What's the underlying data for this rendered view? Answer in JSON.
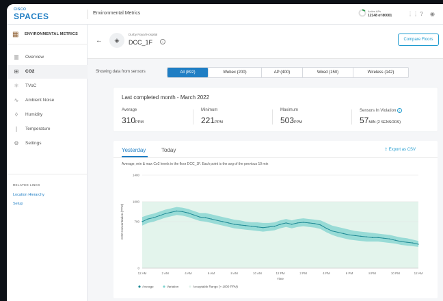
{
  "topbar": {
    "logo_top": "CISCO",
    "logo_main": "SPACES",
    "app_title": "Environmental Metrics",
    "aps_label": "Active APs",
    "aps_value": "12148 of 80001",
    "aps_fraction": 0.15
  },
  "sidebar": {
    "header": "ENVIRONMENTAL METRICS",
    "items": [
      {
        "label": "Overview",
        "icon": "bar-chart-icon"
      },
      {
        "label": "CO2",
        "icon": "co2-icon",
        "active": true
      },
      {
        "label": "TVoC",
        "icon": "molecule-icon"
      },
      {
        "label": "Ambient Noise",
        "icon": "sound-wave-icon"
      },
      {
        "label": "Humidity",
        "icon": "droplet-icon"
      },
      {
        "label": "Temperature",
        "icon": "thermometer-icon"
      },
      {
        "label": "Settings",
        "icon": "gear-icon"
      }
    ],
    "related_title": "RELATED LINKS",
    "related_links": [
      "Location Hierarchy",
      "Setup"
    ]
  },
  "header": {
    "building": "Durby Royal Hospital",
    "floor": "DCC_1F",
    "compare_button": "Compare Floors"
  },
  "filters": {
    "label": "Showing data from sensors",
    "tabs": [
      "All (892)",
      "Webex (200)",
      "AP (400)",
      "Wired (150)",
      "Wireless (142)"
    ],
    "active_index": 0
  },
  "summary": {
    "title": "Last completed month - March 2022",
    "stats": [
      {
        "label": "Average",
        "value": "310",
        "unit": "PPM"
      },
      {
        "label": "Minimum",
        "value": "221",
        "unit": "PPM"
      },
      {
        "label": "Maximum",
        "value": "503",
        "unit": "PPM"
      },
      {
        "label": "Sensors In Violation",
        "value": "57",
        "unit": "MIN (2 SENSORS)"
      }
    ]
  },
  "chart_panel": {
    "tabs": [
      "Yesterday",
      "Today"
    ],
    "active_tab": 0,
    "export": "Export as CSV",
    "description": "Average, min & max Co2 levels in the floor DCC_1F. Each point is the avg of the previous 10 min"
  },
  "colors": {
    "accent": "#1f7ec4",
    "average_line": "#1f8a95",
    "variation": "#7fd3cf",
    "acceptable": "#e3f4ec"
  },
  "chart_data": {
    "type": "area",
    "ylabel": "CO2 Concentration (PPM)",
    "xlabel": "Time",
    "ylim": [
      0,
      1400
    ],
    "yticks": [
      0,
      700,
      1000,
      1400
    ],
    "xlim": [
      0,
      24
    ],
    "xticks": [
      {
        "v": 0,
        "label": "12 AM"
      },
      {
        "v": 2,
        "label": "2 AM"
      },
      {
        "v": 4,
        "label": "4 AM"
      },
      {
        "v": 6,
        "label": "6 AM"
      },
      {
        "v": 8,
        "label": "8 AM"
      },
      {
        "v": 10,
        "label": "10 AM"
      },
      {
        "v": 12,
        "label": "12 PM"
      },
      {
        "v": 14,
        "label": "2 PM"
      },
      {
        "v": 16,
        "label": "4 PM"
      },
      {
        "v": 18,
        "label": "6 PM"
      },
      {
        "v": 20,
        "label": "8 PM"
      },
      {
        "v": 22,
        "label": "10 PM"
      },
      {
        "v": 24,
        "label": "12 AM"
      }
    ],
    "acceptable_max": 1000,
    "x": [
      0,
      0.5,
      1,
      1.5,
      2,
      2.5,
      3,
      3.5,
      4,
      4.5,
      5,
      5.5,
      6,
      6.5,
      7,
      7.5,
      8,
      8.5,
      9,
      9.5,
      10,
      10.5,
      11,
      11.5,
      12,
      12.5,
      13,
      13.5,
      14,
      14.5,
      15,
      15.5,
      16,
      16.5,
      17,
      17.5,
      18,
      18.5,
      19,
      19.5,
      20,
      20.5,
      21,
      21.5,
      22,
      22.5,
      23,
      23.5,
      24
    ],
    "series": [
      {
        "name": "Average",
        "values": [
          700,
          740,
          760,
          790,
          820,
          840,
          860,
          850,
          830,
          800,
          770,
          760,
          740,
          720,
          700,
          680,
          660,
          650,
          640,
          630,
          620,
          610,
          620,
          630,
          660,
          680,
          660,
          680,
          690,
          680,
          670,
          650,
          600,
          560,
          540,
          520,
          500,
          490,
          480,
          470,
          460,
          460,
          450,
          440,
          420,
          400,
          390,
          380,
          360
        ]
      },
      {
        "name": "Variation",
        "upper": [
          770,
          800,
          820,
          850,
          880,
          900,
          920,
          910,
          890,
          860,
          830,
          830,
          810,
          790,
          770,
          750,
          730,
          720,
          700,
          690,
          690,
          680,
          680,
          690,
          720,
          740,
          720,
          740,
          750,
          740,
          730,
          720,
          680,
          640,
          620,
          600,
          580,
          560,
          550,
          540,
          530,
          520,
          510,
          500,
          480,
          460,
          450,
          430,
          410
        ],
        "lower": [
          640,
          680,
          700,
          730,
          760,
          780,
          800,
          790,
          770,
          740,
          710,
          700,
          680,
          660,
          640,
          620,
          600,
          590,
          580,
          570,
          560,
          550,
          560,
          570,
          600,
          620,
          600,
          620,
          630,
          620,
          610,
          590,
          540,
          500,
          470,
          450,
          430,
          420,
          410,
          400,
          400,
          400,
          390,
          380,
          370,
          350,
          340,
          330,
          320
        ]
      }
    ],
    "legend": [
      "Average",
      "Variation",
      "Acceptable Range (> 1000 PPM)"
    ],
    "legend_position": "bottom"
  }
}
